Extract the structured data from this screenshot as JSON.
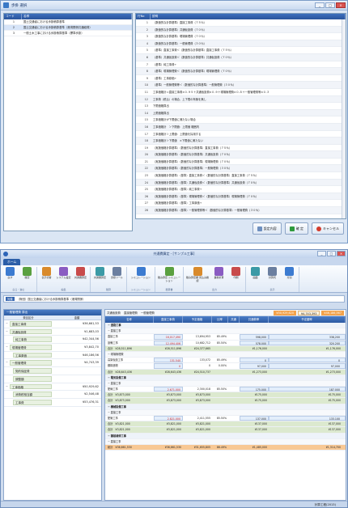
{
  "dialog": {
    "title": "歩掛 選択",
    "left_headers": [
      "コード",
      "名称"
    ],
    "left_rows": [
      {
        "code": "1",
        "name": "国土交通省における歩掛積算基準"
      },
      {
        "code": "2",
        "name": "国土交通省における歩掛積算基準（港湾関係共通経費）"
      },
      {
        "code": "3",
        "name": "一般土木工事における歩掛積算基準（標準歩掛）"
      }
    ],
    "right_headers": [
      "行No",
      "説明"
    ],
    "right_rows": [
      {
        "n": "1",
        "d": "（数値的な計算基準）直接工事費（７５％）"
      },
      {
        "n": "2",
        "d": "（数値的な計算基準）共通仮設費（７０％）"
      },
      {
        "n": "3",
        "d": "（数値的な計算基準）現場管理費（７０％）"
      },
      {
        "n": "4",
        "d": "（数値的な計算基準）一般管理費（３０％）"
      },
      {
        "n": "5",
        "d": "（基準）直接工事費＜（数値的な計算基準）直接工事費（７５％）"
      },
      {
        "n": "6",
        "d": "（基準）共通仮設費＜（数値的な計算基準）共通仮設費（７０％）"
      },
      {
        "n": "7",
        "d": "（基準）純工事費÷"
      },
      {
        "n": "8",
        "d": "（基準）現場管理費＜（数値的な計算基準）現場管理費（７０％）"
      },
      {
        "n": "9",
        "d": "（基準）工事原価÷"
      },
      {
        "n": "10",
        "d": "（基準）一般管理費等＜（数値的な計算基準）一般管理費（３０％）"
      },
      {
        "n": "11",
        "d": "工事価格計＝直接工事費×０.９５＋共通仮設費×０.９＋現場管理費×０.８＋一般管理費等×０.３"
      },
      {
        "n": "12",
        "d": "工事費（税込）の場合、上下限の有無を無し"
      },
      {
        "n": "13",
        "d": "下限価格算出"
      },
      {
        "n": "14",
        "d": "上限価格算出"
      },
      {
        "n": "15",
        "d": "工事価格計が下限値に満たない場合"
      },
      {
        "n": "16",
        "d": "工事価格計　＞下限値：上限値 範囲内"
      },
      {
        "n": "17",
        "d": "工事価格計＞上限値：上限値を採用する"
      },
      {
        "n": "18",
        "d": "工事価格計＞下限値　×下限値に満たない"
      },
      {
        "n": "19",
        "d": "（実施価格計算基準）（数値的な計算基準）直接工事費（７５％）"
      },
      {
        "n": "20",
        "d": "（実施価格計算基準）（数値的な計算基準）共通仮設費（７０％）"
      },
      {
        "n": "21",
        "d": "（実施価格計算基準）（数値的な計算基準）現場管理費（７０％）"
      },
      {
        "n": "22",
        "d": "（実施価格計算基準）（数値的な計算基準）一般管理費（３０％）"
      },
      {
        "n": "23",
        "d": "（実施価格計算基準）（基準）直接工事費＜（数値的な計算基準）直接工事費（７５％）"
      },
      {
        "n": "24",
        "d": "（実施価格計算基準）（基準）共通仮設費＜（数値的な計算基準）共通仮設費（７０％）"
      },
      {
        "n": "25",
        "d": "（実施価格計算基準）（基準）純工事費÷"
      },
      {
        "n": "26",
        "d": "（実施価格計算基準）（基準）現場管理費＜（数値的な計算基準）現場管理費（７０％）"
      },
      {
        "n": "27",
        "d": "（実施価格計算基準）（基準）工事原価÷"
      },
      {
        "n": "28",
        "d": "（実施価格計算基準）（基準）一般管理費等＜（数値的な計算基準）一般管理費（３０％）"
      }
    ],
    "buttons": {
      "settings": "設定内容",
      "ok": "確 定",
      "cancel": "キャンセル"
    }
  },
  "app": {
    "title": "共通費算定 - [サンプル工事]",
    "tab": "ホーム",
    "ribbon_groups": [
      {
        "name": "戻る・進む",
        "buttons": [
          "戻す",
          "確定"
        ]
      },
      {
        "name": "編集",
        "buttons": [
          "表示切替",
          "システム設定",
          "共通費算定"
        ]
      },
      {
        "name": "積算",
        "buttons": [
          "共通費算定",
          "歩掛ツール"
        ]
      },
      {
        "name": "シミュレーション",
        "buttons": [
          "シミュレーション"
        ]
      },
      {
        "name": "積算書",
        "buttons": [
          "積み算定 シミュレーション"
        ]
      },
      {
        "name": "出力",
        "buttons": [
          "積み算定額 見込み確認",
          "事前計算",
          "印刷"
        ]
      },
      {
        "name": "表示",
        "buttons": [
          "画面",
          "計算式",
          "分割"
        ]
      }
    ],
    "docbar": {
      "tag": "対象",
      "text": "（財団）国土交通省における歩掛積算基準（港湾関係）"
    },
    "aside": {
      "title": "一般管理費 算出",
      "headers": [
        "費目区分",
        "金額"
      ],
      "rows": [
        {
          "ex": "−",
          "name": "直接工事費",
          "val": "¥36,661,53",
          "lvl": 1
        },
        {
          "ex": "−",
          "name": "共通仮設費",
          "val": "¥1,683,03",
          "lvl": 1
        },
        {
          "ex": "",
          "name": "純工事費",
          "val": "¥42,344,56",
          "lvl": 2
        },
        {
          "ex": "−",
          "name": "現場管理費",
          "val": "¥3,842,70",
          "lvl": 1
        },
        {
          "ex": "",
          "name": "工事原価",
          "val": "¥46,186,56",
          "lvl": 2
        },
        {
          "ex": "−",
          "name": "一般管理費",
          "val": "¥4,743,39",
          "lvl": 1
        },
        {
          "ex": "",
          "name": "契約保証費",
          "val": "",
          "lvl": 2
        },
        {
          "ex": "",
          "name": "調整額",
          "val": "",
          "lvl": 2
        },
        {
          "ex": "−",
          "name": "工事価格",
          "val": "¥50,929,62",
          "lvl": 1
        },
        {
          "ex": "",
          "name": "消費税相当額",
          "val": "¥2,546,48",
          "lvl": 2
        },
        {
          "ex": "",
          "name": "工事費",
          "val": "¥53,476,31",
          "lvl": 2
        }
      ]
    },
    "grid": {
      "filter1": "共通仮設費",
      "filter2": "直接管理費",
      "filter3": "一般管理費",
      "totals": [
        "¥50,929,620",
        "¥4,743,393",
        "¥46,186,567"
      ],
      "headers": [
        "名称",
        "直接工事費",
        "予定価格",
        "比率",
        "共通",
        "共通費率",
        "予定額率"
      ],
      "rows": [
        {
          "type": "sec",
          "c": [
            "− 道路工事",
            "",
            "",
            "",
            "",
            "",
            ""
          ]
        },
        {
          "type": "sub",
          "c": [
            "  − 直接工事",
            "",
            "",
            "",
            "",
            "",
            ""
          ]
        },
        {
          "type": "row",
          "c": [
            "    直接工事",
            "16,017,490",
            "13,694,953",
            "85.49%",
            "",
            "598,000",
            "338,200"
          ]
        },
        {
          "type": "row",
          "c": [
            "    設備工事",
            "12,494,406",
            "10,682,712",
            "85.50%",
            "",
            "578,000",
            "320,200"
          ]
        },
        {
          "type": "tot",
          "c": [
            "  合計　¥28,511,896",
            "¥28,511,896",
            "¥24,377,665",
            "",
            "",
            "¥1,176,000",
            "¥1,176,000"
          ]
        },
        {
          "type": "sub",
          "c": [
            "  − 現場管理費",
            "",
            "",
            "",
            "",
            "",
            ""
          ]
        },
        {
          "type": "row",
          "c": [
            "    高架仮設工事",
            "131,540",
            "133,072",
            "85.49%",
            "",
            "0",
            "0"
          ]
        },
        {
          "type": "row",
          "c": [
            "    鋼構造物",
            "0",
            "0",
            "0.00%",
            "",
            "97,000",
            "97,000"
          ]
        },
        {
          "type": "tot",
          "c": [
            "  合計　¥28,643,436",
            "¥28,643,436",
            "¥24,510,737",
            "",
            "",
            "¥1,273,000",
            "¥1,273,000"
          ]
        },
        {
          "type": "sec",
          "c": [
            "− 電気設備工事",
            "",
            "",
            "",
            "",
            "",
            ""
          ]
        },
        {
          "type": "sub",
          "c": [
            "  − 直接工事",
            "",
            "",
            "",
            "",
            "",
            ""
          ]
        },
        {
          "type": "row",
          "c": [
            "    配線工事",
            "2,671,000",
            "2,300,018",
            "85.50%",
            "",
            "175,000",
            "187,000"
          ]
        },
        {
          "type": "tot",
          "c": [
            "  合計　¥3,873,000",
            "¥3,873,000",
            "¥3,873,000",
            "",
            "",
            "¥175,000",
            "¥175,000"
          ]
        },
        {
          "type": "tot",
          "c": [
            "  合計　¥3,873,000",
            "¥3,873,000",
            "¥3,873,000",
            "",
            "",
            "¥175,000",
            "¥175,000"
          ]
        },
        {
          "type": "sec",
          "c": [
            "− 機械設備工事",
            "",
            "",
            "",
            "",
            "",
            ""
          ]
        },
        {
          "type": "sub",
          "c": [
            "  − 直接工事",
            "",
            "",
            "",
            "",
            "",
            ""
          ]
        },
        {
          "type": "row",
          "c": [
            "    配管工事",
            "2,821,000",
            "2,411,555",
            "85.50%",
            "",
            "137,000",
            "133,100"
          ]
        },
        {
          "type": "tot",
          "c": [
            "  合計　¥3,821,000",
            "¥3,821,000",
            "¥3,821,000",
            "",
            "",
            "¥137,000",
            "¥137,000"
          ]
        },
        {
          "type": "tot",
          "c": [
            "  合計　¥3,821,000",
            "¥3,821,000",
            "¥3,821,000",
            "",
            "",
            "¥137,000",
            "¥137,000"
          ]
        },
        {
          "type": "sec",
          "c": [
            "− 舗装補修工事",
            "",
            "",
            "",
            "",
            "",
            ""
          ]
        },
        {
          "type": "sub",
          "c": [
            "  − 直接工事",
            "",
            "",
            "",
            "",
            "",
            ""
          ]
        },
        {
          "type": "gtot",
          "c": [
            "総計　¥36,661,530",
            "¥36,661,530",
            "¥31,655,805",
            "86.49%",
            "",
            "¥1,485,000",
            "¥1,314,700"
          ]
        }
      ]
    },
    "status": "計算工程(2013)"
  }
}
